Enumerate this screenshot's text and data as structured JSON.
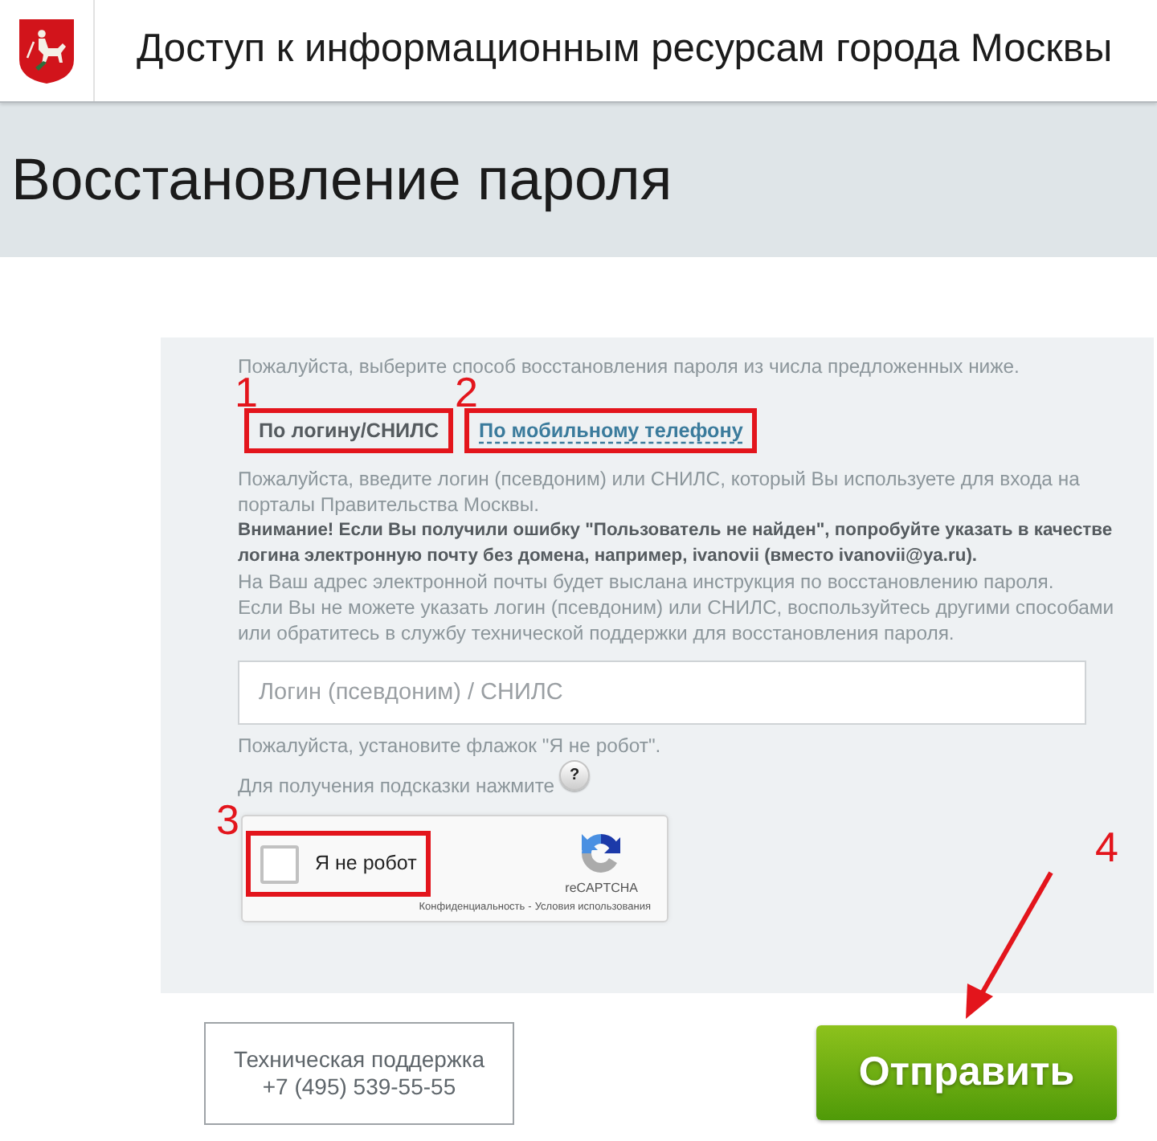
{
  "header": {
    "title": "Доступ к информационным ресурсам города Москвы"
  },
  "page_title": "Восстановление пароля",
  "form": {
    "intro": "Пожалуйста, выберите способ восстановления пароля из числа предложенных ниже.",
    "tabs": [
      {
        "label": "По логину/СНИЛС",
        "selected": true,
        "highlighted": true,
        "callout": "1"
      },
      {
        "label": "По мобильному телефону",
        "selected": false,
        "highlighted": true,
        "callout": "2"
      }
    ],
    "instructions": [
      {
        "kind": "note",
        "text": "Пожалуйста, введите логин (псевдоним) или СНИЛС, который Вы используете для входа на порталы Правительства Москвы."
      },
      {
        "kind": "warning",
        "text": "Внимание! Если Вы получили ошибку \"Пользователь не найден\", попробуйте указать в качестве логина электронную почту без домена, например, ivanovii (вместо ivanovii@ya.ru)."
      },
      {
        "kind": "note",
        "text": "На Ваш адрес электронной почты будет выслана инструкция по восстановлению пароля."
      },
      {
        "kind": "note",
        "text": "Если Вы не можете указать логин (псевдоним) или СНИЛС, воспользуйтесь другими способами или обратитесь в службу технической поддержки для восстановления пароля."
      }
    ],
    "login_field": {
      "placeholder": "Логин (псевдоним) / СНИЛС"
    },
    "captcha_hint": "Пожалуйста, установите флажок \"Я не робот\".",
    "help_hint": {
      "text": "Для получения подсказки нажмите",
      "button": "?"
    },
    "captcha": {
      "label": "Я не робот",
      "checked": false,
      "highlighted": true,
      "callout": "3",
      "logo_text": "reCAPTCHA",
      "links": [
        "Конфиденциальность",
        "Условия использования"
      ],
      "separator": "-"
    }
  },
  "support": {
    "title": "Техническая поддержка",
    "phone": "+7 (495) 539-55-55"
  },
  "submit_button": {
    "label": "Отправить",
    "callout": "4",
    "pointer": true
  }
}
